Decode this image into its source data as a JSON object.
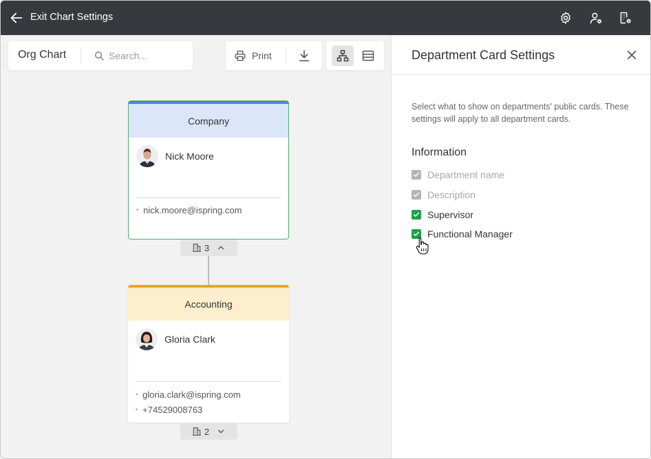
{
  "topbar": {
    "title": "Exit Chart Settings",
    "icons": [
      "arrow-left-icon",
      "gear-icon",
      "user-settings-icon",
      "building-settings-icon"
    ]
  },
  "toolbar": {
    "view_title": "Org Chart",
    "search_placeholder": "Search...",
    "print_label": "Print",
    "icons": [
      "search-icon",
      "printer-icon",
      "download-icon",
      "org-view-icon",
      "list-view-icon"
    ],
    "active_view": "org"
  },
  "org": {
    "company": {
      "title": "Company",
      "accent_color": "#4b86d6",
      "person": {
        "name": "Nick Moore",
        "email": "nick.moore@ispring.com"
      },
      "children_count": "3",
      "expanded": true
    },
    "accounting": {
      "title": "Accounting",
      "accent_color": "#e9a916",
      "person": {
        "name": "Gloria Clark",
        "email": "gloria.clark@ispring.com",
        "phone": "+74529008763"
      },
      "children_count": "2",
      "expanded": false
    }
  },
  "panel": {
    "title": "Department Card Settings",
    "description": "Select what to show on departments' public cards. These settings will apply to all department cards.",
    "section_title": "Information",
    "options": [
      {
        "label": "Department name",
        "checked": true,
        "disabled": true
      },
      {
        "label": "Description",
        "checked": true,
        "disabled": true
      },
      {
        "label": "Supervisor",
        "checked": true,
        "disabled": false
      },
      {
        "label": "Functional Manager",
        "checked": true,
        "disabled": false
      }
    ],
    "check_color": "#1fa04b"
  }
}
